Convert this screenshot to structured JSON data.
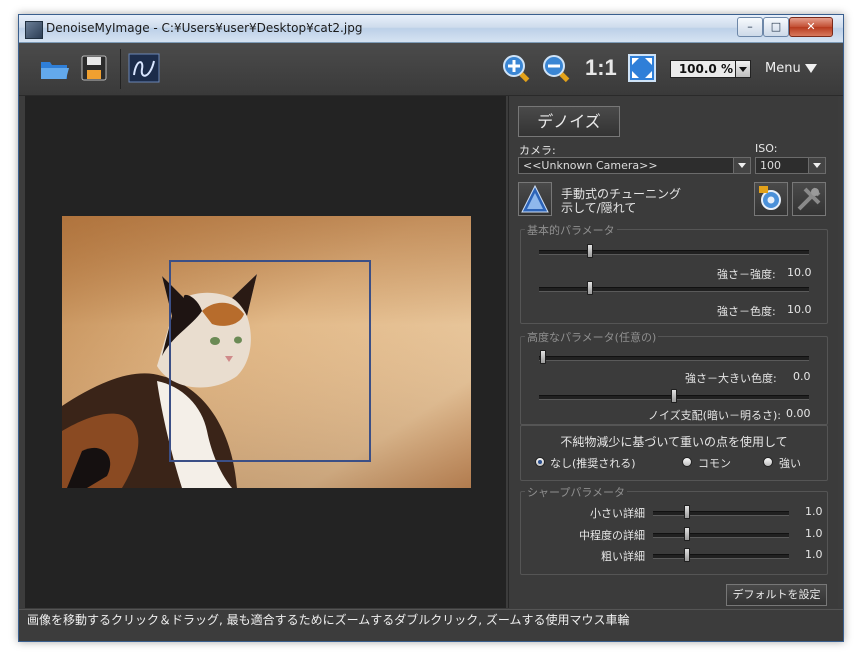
{
  "window": {
    "title": "DenoiseMyImage - C:¥Users¥user¥Desktop¥cat2.jpg",
    "minimize_glyph": "–",
    "maximize_glyph": "□",
    "close_glyph": "✕"
  },
  "toolbar": {
    "zoom_one_label": "1:1",
    "zoom_value": "100.0 %",
    "menu_label": "Menu"
  },
  "panel": {
    "denoise_button": "デノイズ",
    "camera_label": "カメラ:",
    "camera_value": "<<Unknown Camera>>",
    "iso_label": "ISO:",
    "iso_value": "100",
    "tuning_line1": "手動式のチューニング",
    "tuning_line2": "示して/隠れて",
    "basic_group": "基本的パラメータ",
    "basic": [
      {
        "label": "強さ－強度:",
        "value": "10.0",
        "level": 0.19
      },
      {
        "label": "強さ－色度:",
        "value": "10.0",
        "level": 0.19
      }
    ],
    "advanced_group": "高度なパラメータ(任意の)",
    "advanced": [
      {
        "label": "強さ－大きい色度:",
        "value": "0.0",
        "level": 0.0
      },
      {
        "label": "ノイズ支配(暗い－明るさ):",
        "value": "0.00",
        "level": 0.5
      }
    ],
    "impulse_title": "不純物減少に基づいて重いの点を使用して",
    "impulse_options": [
      "なし(推奨される)",
      "コモン",
      "強い"
    ],
    "impulse_selected": 0,
    "sharp_group": "シャープパラメータ",
    "sharp": [
      {
        "label": "小さい詳細",
        "value": "1.0",
        "level": 0.25
      },
      {
        "label": "中程度の詳細",
        "value": "1.0",
        "level": 0.25
      },
      {
        "label": "粗い詳細",
        "value": "1.0",
        "level": 0.25
      }
    ],
    "default_button": "デフォルトを設定"
  },
  "status_text": "画像を移動するクリック＆ドラッグ, 最も適合するためにズームするダブルクリック, ズームする使用マウス車輪",
  "colors": {
    "background": "#3b3b3b",
    "canvas": "#232323",
    "selection": "#3b4f86",
    "icon_blue": "#4a90d9"
  },
  "icons": [
    "open-folder-icon",
    "save-disk-icon",
    "dmi-logo-icon",
    "zoom-in-icon",
    "zoom-out-icon",
    "fit-screen-icon",
    "chevron-down-icon",
    "tuning-triangle-icon",
    "settings-icon",
    "tools-icon"
  ]
}
